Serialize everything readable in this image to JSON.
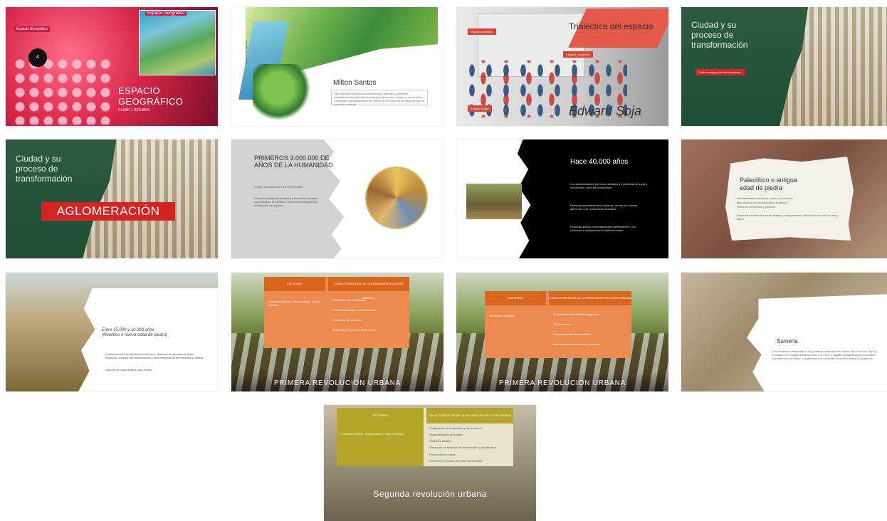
{
  "slides": {
    "s1": {
      "title_line1": "ESPACIO",
      "title_line2": "GEOGRÁFICO",
      "subtitle": "CLASE 1 RED BEN",
      "map_title": "Espacio Geográfico",
      "badge_label": "Espacio Geográfico",
      "circle_label": "4"
    },
    "s2": {
      "title": "Milton Santos",
      "body": "Todo humano con sus conocimientos y saberes, y también contradicciones ejecutan su trabajo y tienen en el acoso a un conjunto. Constante y simultáneamente, éste y es un conjunto principal de que se unen las contexto.",
      "vertical_text": "Espacio geográfico"
    },
    "s3": {
      "title": "Trialéctica del espacio",
      "name": "Edward Soja",
      "tag1": "Espacio percibido",
      "tag2": "Espacio concebido",
      "tag3": "Espacio vivido"
    },
    "s4": {
      "title_line1": "Ciudad y su",
      "title_line2": "proceso de",
      "title_line3": "transformación",
      "tag": "Ciudad antigua (ciudad medieval)"
    },
    "s5": {
      "title_line1": "Ciudad y su",
      "title_line2": "proceso de",
      "title_line3": "transformación",
      "highlight": "AGLOMERACIÓN"
    },
    "s6": {
      "title": "PRIMEROS 3.000.000 DE AÑOS DE LA HUMANIDAD",
      "bullet1": "Grupos nómadas de 20 a 30 personas",
      "bullet2": "Vivían del pillaje, pescadores y recolectores, cazar y practicaban el cambio a través de la búsqueda y recolección de comida."
    },
    "s7": {
      "title": "Hace 40.000 años",
      "bullet1": "Los asentamientos primeros ubicados en prácticas de caza y recolección, pero en permanente.",
      "bullet2": "Primeras asentamientos humanos, donde se cultivan alimentos y se domestican animales.",
      "bullet3": "Primeras aldeas y asentamientos permanentes, con viviendas e instalaciones multifuncionales."
    },
    "s8": {
      "title_line1": "Paleolítico o antigua",
      "title_line2": "edad de piedra",
      "bullet1": "Asentamientos humanos, caza y recolección",
      "bullet2": "Manufactura de herramientas de piedra",
      "bullet3": "Primeras cerámicas y pinturas",
      "bullet4": "Primeras construcciones de aldeas y campamentos ubicados cerca de los ríos y lagos."
    },
    "s9": {
      "title_line1": "Entre 15.000 y 10.000 años",
      "title_line2": "(Neolítico o nueva edad de piedra)",
      "bullet1": "Producción de excedentes económicos, sistemas de almacenamiento, irrigación, creación de herramientas y la domesticación de animales y plantas.",
      "bullet2": "Agricultura organizada a gran escala"
    },
    "s10": {
      "col1_header": "SECTORES",
      "col2_header": "CARACTERÍSTICAS DE LA PRIMERA REVOLUCIÓN URBANA",
      "row1_left": "Comercio-Estado - Mesopotamia - Asia y América",
      "row1_items": [
        "Producción de excedentes",
        "Primeras ciudades, asentamientos",
        "Desarrollo del comercio",
        "Desarrollo e invención de la rueda"
      ],
      "banner": "PRIMERA REVOLUCIÓN URBANA"
    },
    "s11": {
      "col1_header": "SECTORES",
      "col2_header": "CARACTERÍSTICAS DE LA PRIMERA REVOLUCIÓN URBANA",
      "row1_left": "Revolución neolítica",
      "row1_items": [
        "Producción de excedentes agrícolas",
        "Sedentarismo",
        "Sistemas de almacenamiento",
        "Domesticación de plantas y animales"
      ],
      "banner": "PRIMERA REVOLUCIÓN URBANA"
    },
    "s12": {
      "title": "Sumeria",
      "body": "Los Sumerios desarrollaron las primeras ciudades del mundo entre los ríos Tigris y Éufrates, con ciudades estado como Ur, Uruk y Lagash. Desarrollaron la escritura cuneiforme y la rueda, y organizaron su sociedad en torno a templos y palacios."
    },
    "s13": {
      "col1_header": "SECTORES",
      "col2_header": "CARACTERÍSTICAS DE LA SEGUNDA REVOLUCIÓN URBANA",
      "row1_left": "Comercio-Estado - Mesopotamia - Asia y América",
      "row1_items": [
        "Surgimiento de la escritura y los números",
        "Especialización del trabajo",
        "Ciudades-Estado",
        "Desarrollo de técnicas de construcción y arquitectura",
        "Producción en masa",
        "Comercio y creación de rutas comerciales"
      ],
      "banner": "Segunda revolución urbana"
    }
  }
}
